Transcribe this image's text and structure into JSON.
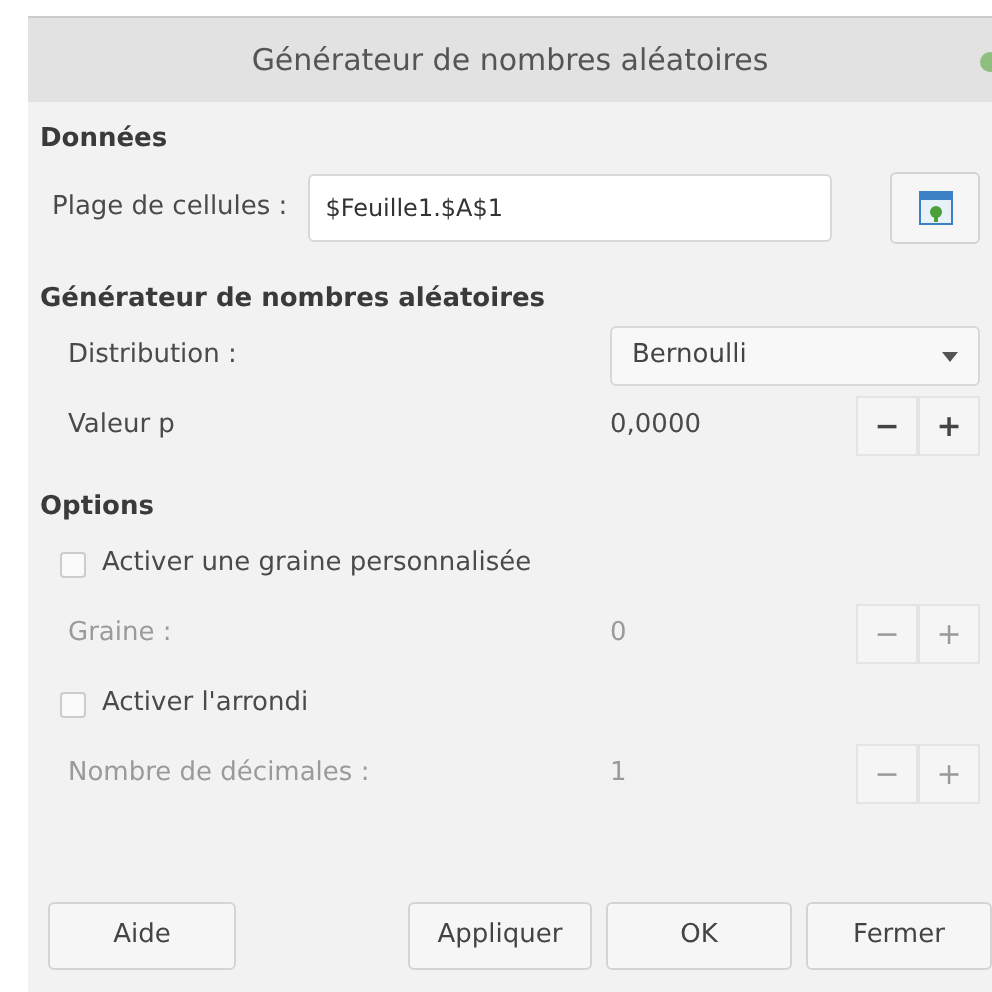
{
  "window": {
    "title": "Générateur de nombres aléatoires"
  },
  "sections": [
    {
      "heading": "Données",
      "rows": [
        {
          "kind": "range",
          "label": "Plage de cellules :",
          "value": "$Feuille1.$A$1"
        }
      ]
    },
    {
      "heading": "Générateur de nombres aléatoires",
      "rows": [
        {
          "kind": "dropdown",
          "label": "Distribution :",
          "value": "Bernoulli"
        },
        {
          "kind": "spin",
          "label": "Valeur p",
          "value": "0,0000",
          "disabled": false,
          "decrement": "−",
          "increment": "+"
        }
      ]
    },
    {
      "heading": "Options",
      "rows": [
        {
          "kind": "checkbox",
          "label": "Activer une graine personnalisée",
          "checked": false
        },
        {
          "kind": "spin",
          "label": "Graine :",
          "value": "0",
          "disabled": true,
          "decrement": "−",
          "increment": "+"
        },
        {
          "kind": "checkbox",
          "label": "Activer l'arrondi",
          "checked": false
        },
        {
          "kind": "spin",
          "label": "Nombre de décimales :",
          "value": "1",
          "disabled": true,
          "decrement": "−",
          "increment": "+"
        }
      ]
    }
  ],
  "buttons": [
    "Aide",
    "Appliquer",
    "OK",
    "Fermer"
  ]
}
